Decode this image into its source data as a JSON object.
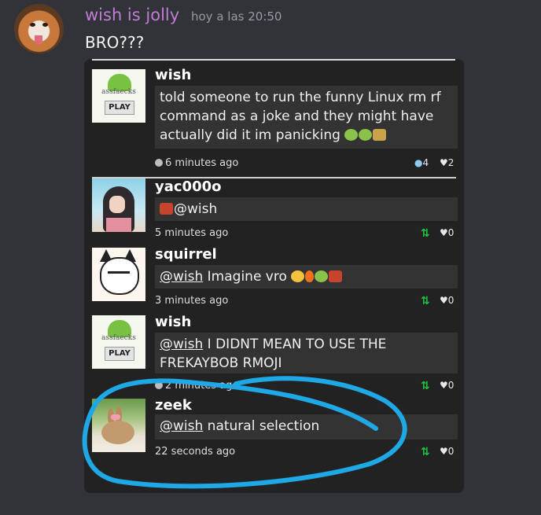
{
  "message": {
    "author": "wish is jolly",
    "timestamp": "hoy a las 20:50",
    "text": "BRO???"
  },
  "embed": {
    "posts": [
      {
        "author": "wish",
        "avatar_icon": "game-logo-avatar",
        "avatar_text": "assfaecks",
        "avatar_button": "PLAY",
        "body": "told someone to run the funny Linux rm rf command as a joke and they might have actually did it im panicking",
        "time": "6 minutes ago",
        "reply_count": "4",
        "like_count": "2"
      },
      {
        "author": "yac000o",
        "avatar_icon": "anime-girl-avatar",
        "mention": "@wish",
        "body": "",
        "time": "5 minutes ago",
        "like_count": "0"
      },
      {
        "author": "squirrel",
        "avatar_icon": "cartoon-cat-avatar",
        "mention": "@wish",
        "body": " Imagine vro",
        "time": "3 minutes ago",
        "like_count": "0"
      },
      {
        "author": "wish",
        "avatar_icon": "game-logo-avatar",
        "avatar_text": "assfaecks",
        "avatar_button": "PLAY",
        "mention": "@wish",
        "body": " I DIDNT MEAN TO USE THE FREKAYBOB RMOJI",
        "time": "2 minutes ago",
        "like_count": "0"
      },
      {
        "author": "zeek",
        "avatar_icon": "bunny-avatar",
        "mention": "@wish",
        "body": " natural selection",
        "time": "22 seconds ago",
        "like_count": "0"
      }
    ]
  },
  "colors": {
    "background": "#313338",
    "username": "#c27cd6",
    "annotation_stroke": "#1ea8e6",
    "upvote": "#20c040"
  }
}
